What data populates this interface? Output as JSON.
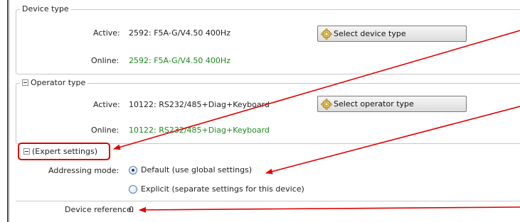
{
  "device_type": {
    "title": "Device type",
    "active_label": "Active:",
    "active_value": "2592: F5A-G/V4.50 400Hz",
    "online_label": "Online:",
    "online_value": "2592: F5A-G/V4.50 400Hz",
    "button_label": "Select device type"
  },
  "operator_type": {
    "title": "Operator type",
    "active_label": "Active:",
    "active_value": "10122: RS232/485+Diag+Keyboard",
    "online_label": "Online:",
    "online_value": "10122: RS232/485+Diag+Keyboard",
    "button_label": "Select operator type"
  },
  "expert_settings": {
    "title": "(Expert settings)",
    "addressing_label": "Addressing mode:",
    "options": [
      {
        "label": "Default (use global settings)",
        "checked": true
      },
      {
        "label": "Explicit (separate settings for this device)",
        "checked": false
      }
    ],
    "device_reference_label": "Device reference:",
    "device_reference_value": "0"
  },
  "annotation_color": "#e00000",
  "online_value_color": "#1e8a1e"
}
